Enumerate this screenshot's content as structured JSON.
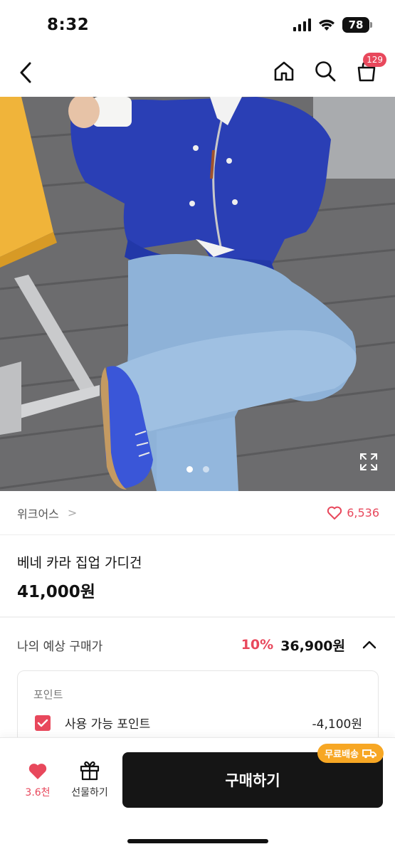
{
  "status_bar": {
    "time": "8:32",
    "battery": "78"
  },
  "nav": {
    "cart_badge": "129"
  },
  "hero": {
    "image_count": 2,
    "active_index": 0
  },
  "brand": {
    "name": "위크어스",
    "chevron": ">",
    "likes": "6,536"
  },
  "product": {
    "name": "베네 카라 집업 가디건",
    "price": "41,000원"
  },
  "expected_price": {
    "label": "나의 예상 구매가",
    "discount": "10%",
    "price": "36,900원"
  },
  "points": {
    "title": "포인트",
    "label": "사용 가능 포인트",
    "value": "-4,100원",
    "checked": true
  },
  "bottom_bar": {
    "wish_count": "3.6천",
    "gift_label": "선물하기",
    "buy_label": "구매하기",
    "free_shipping": "무료배송"
  },
  "colors": {
    "accent": "#e8485c",
    "buy_button": "#151515",
    "shipping_badge": "#f7a724"
  },
  "icons": [
    "signal-icon",
    "wifi-icon",
    "battery-icon",
    "back-icon",
    "home-icon",
    "search-icon",
    "shopping-bag-icon",
    "expand-icon",
    "heart-outline-icon",
    "chevron-up-icon",
    "checkbox-icon",
    "heart-filled-icon",
    "gift-icon",
    "truck-icon"
  ]
}
